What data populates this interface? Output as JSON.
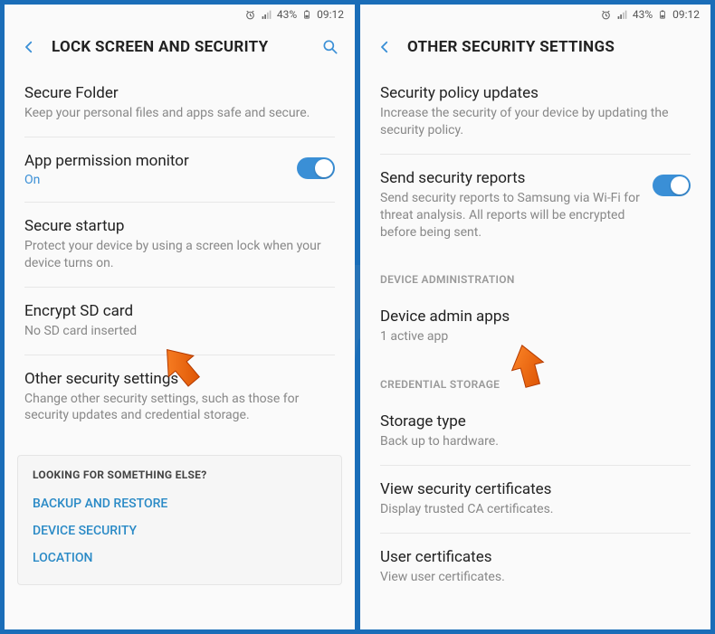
{
  "status": {
    "battery": "43%",
    "time": "09:12"
  },
  "left": {
    "title": "LOCK SCREEN AND SECURITY",
    "items": [
      {
        "title": "Secure Folder",
        "sub": "Keep your personal files and apps safe and secure."
      },
      {
        "title": "App permission monitor",
        "status": "On",
        "toggle": true
      },
      {
        "title": "Secure startup",
        "sub": "Protect your device by using a screen lock when your device turns on."
      },
      {
        "title": "Encrypt SD card",
        "sub": "No SD card inserted"
      },
      {
        "title": "Other security settings",
        "sub": "Change other security settings, such as those for security updates and credential storage."
      }
    ],
    "footer": {
      "label": "LOOKING FOR SOMETHING ELSE?",
      "links": [
        "BACKUP AND RESTORE",
        "DEVICE SECURITY",
        "LOCATION"
      ]
    }
  },
  "right": {
    "title": "OTHER SECURITY SETTINGS",
    "items": [
      {
        "title": "Security policy updates",
        "sub": "Increase the security of your device by updating the security policy."
      },
      {
        "title": "Send security reports",
        "sub": "Send security reports to Samsung via Wi-Fi for threat analysis. All reports will be encrypted before being sent.",
        "toggle": true
      }
    ],
    "section1": "DEVICE ADMINISTRATION",
    "admin": {
      "title": "Device admin apps",
      "sub": "1 active app"
    },
    "section2": "CREDENTIAL STORAGE",
    "cred": [
      {
        "title": "Storage type",
        "sub": "Back up to hardware."
      },
      {
        "title": "View security certificates",
        "sub": "Display trusted CA certificates."
      },
      {
        "title": "User certificates",
        "sub": "View user certificates."
      }
    ]
  }
}
